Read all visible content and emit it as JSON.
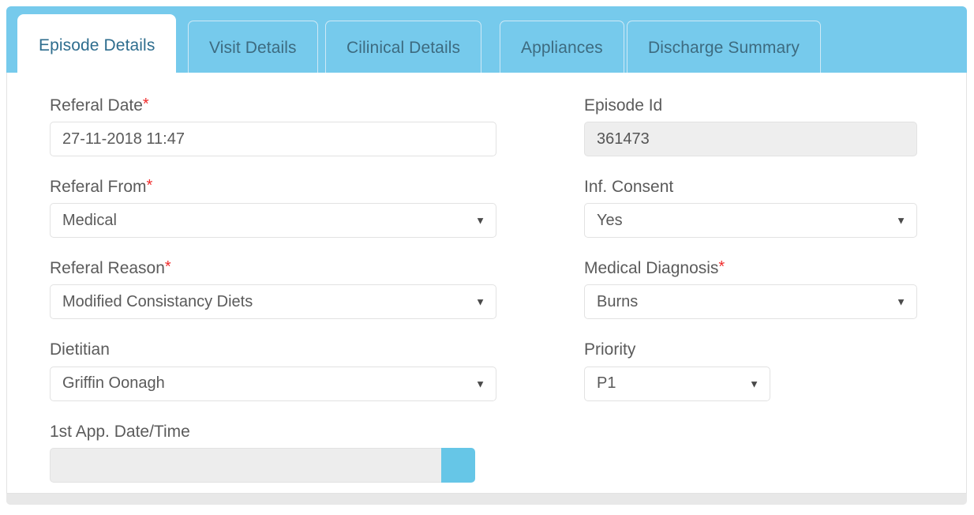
{
  "tabs": [
    {
      "label": "Episode Details",
      "active": true
    },
    {
      "label": "Visit Details",
      "active": false
    },
    {
      "label": "Cilinical Details",
      "active": false
    },
    {
      "label": "Appliances",
      "active": false
    },
    {
      "label": "Discharge Summary",
      "active": false
    }
  ],
  "colors": {
    "tab_bar_blue": "#76caec",
    "button_blue": "#66c6e7",
    "required_red": "#f02b2b",
    "disabled_grey": "#eeeeee",
    "label_grey": "#5b5b5b"
  },
  "form": {
    "left": {
      "referal_date": {
        "label": "Referal Date",
        "required_marker": "*",
        "value": "27-11-2018 11:47"
      },
      "referal_from": {
        "label": "Referal From",
        "required_marker": "*",
        "value": "Medical",
        "caret": "▼"
      },
      "referal_reason": {
        "label": "Referal Reason",
        "required_marker": "*",
        "value": "Modified Consistancy Diets",
        "caret": "▼"
      },
      "dietitian": {
        "label": "Dietitian",
        "value": "Griffin Oonagh",
        "caret": "▼"
      },
      "first_app_datetime": {
        "label": "1st App. Date/Time",
        "value": "",
        "button_label": ""
      }
    },
    "right": {
      "episode_id": {
        "label": "Episode Id",
        "value": "361473"
      },
      "inf_consent": {
        "label": "Inf. Consent",
        "value": "Yes",
        "caret": "▼"
      },
      "medical_diagnosis": {
        "label": "Medical Diagnosis",
        "required_marker": "*",
        "value": "Burns",
        "caret": "▼"
      },
      "priority": {
        "label": "Priority",
        "value": "P1",
        "caret": "▼"
      }
    }
  }
}
